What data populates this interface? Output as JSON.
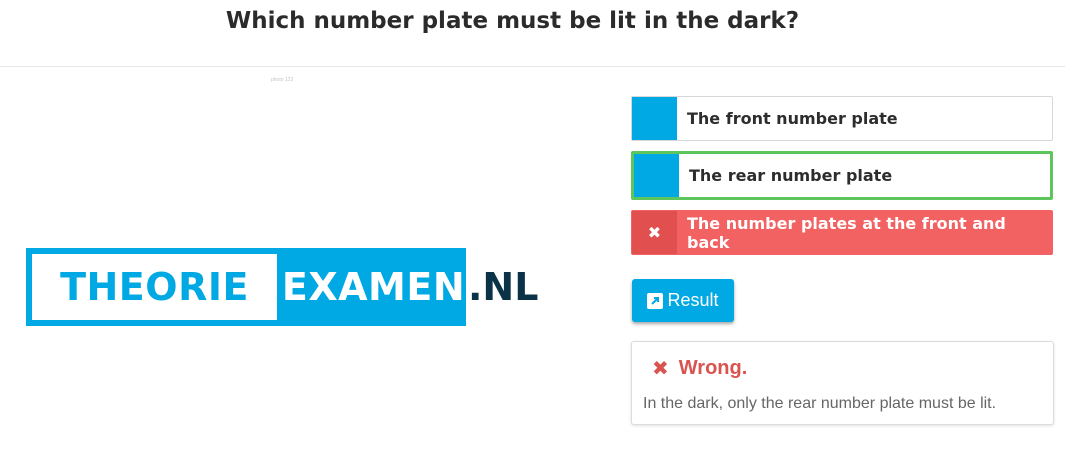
{
  "question": {
    "title": "Which number plate must be lit in the dark?",
    "image_caption": "photo 123"
  },
  "logo": {
    "left_text": "THEORIE",
    "right_text": "EXAMEN",
    "suffix": ".NL",
    "brand_color": "#00a9e3",
    "dark_color": "#0b3347"
  },
  "answers": [
    {
      "label": "The front number plate",
      "state": "neutral"
    },
    {
      "label": "The rear number plate",
      "state": "correct"
    },
    {
      "label": "The number plates at the front and back",
      "state": "selected-wrong",
      "icon": "close-icon"
    }
  ],
  "result_button": {
    "label": "Result",
    "icon": "external-link-icon"
  },
  "feedback": {
    "status": "Wrong.",
    "icon": "close-icon",
    "explanation": "In the dark, only the rear number plate must be lit."
  },
  "colors": {
    "accent": "#00a9e3",
    "correct_border": "#5cc65c",
    "wrong": "#f36262",
    "wrong_text": "#d9534f"
  }
}
